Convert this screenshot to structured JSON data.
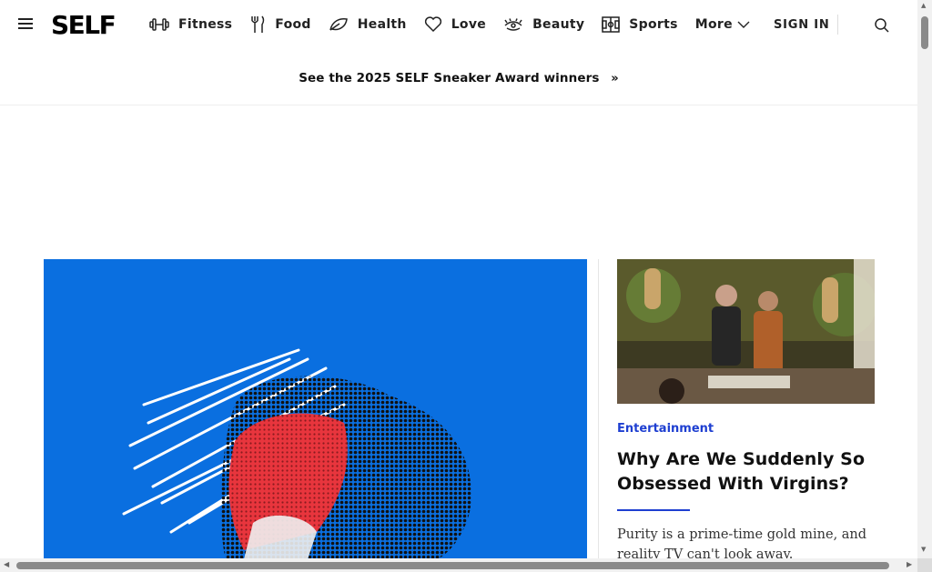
{
  "header": {
    "logo": "SELF",
    "nav": [
      {
        "label": "Fitness",
        "icon": "dumbbell-icon"
      },
      {
        "label": "Food",
        "icon": "fork-knife-icon"
      },
      {
        "label": "Health",
        "icon": "leaf-icon"
      },
      {
        "label": "Love",
        "icon": "heart-icon"
      },
      {
        "label": "Beauty",
        "icon": "eye-lashes-icon"
      },
      {
        "label": "Sports",
        "icon": "field-icon"
      }
    ],
    "more_label": "More",
    "signin_label": "SIGN IN"
  },
  "promo": {
    "text": "See the 2025 SELF Sneaker Award winners",
    "arrow": "»"
  },
  "side_article": {
    "kicker": "Entertainment",
    "headline": "Why Are We Suddenly So Obsessed With Virgins?",
    "dek": "Purity is a prime-time gold mine, and reality TV can't look away."
  },
  "colors": {
    "accent": "#1e3fd1",
    "hero_bg": "#0a6fe0",
    "hero_red": "#e8353d"
  }
}
